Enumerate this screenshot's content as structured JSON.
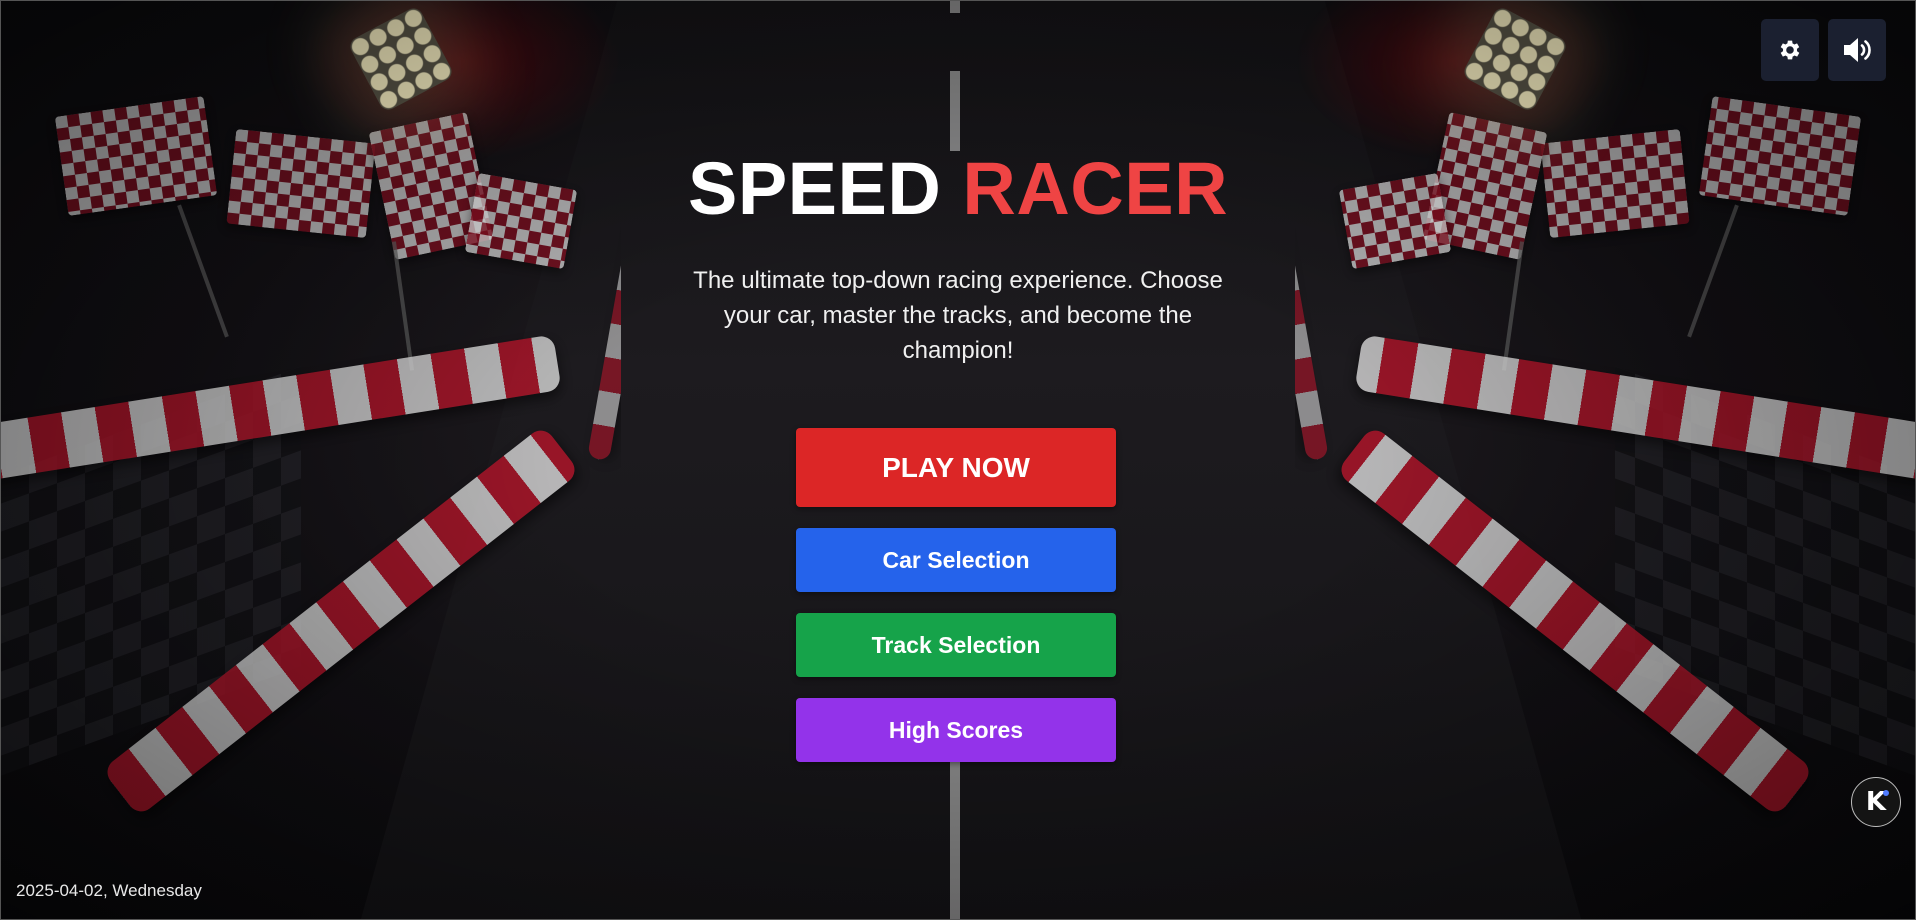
{
  "header": {
    "settings_icon": "gear-icon",
    "sound_icon": "volume-icon"
  },
  "hero": {
    "title_main": "SPEED",
    "title_accent": "RACER",
    "tagline": "The ultimate top-down racing experience. Choose your car, master the tracks, and become the champion!"
  },
  "menu": {
    "play": "PLAY NOW",
    "cars": "Car Selection",
    "tracks": "Track Selection",
    "scores": "High Scores"
  },
  "footer": {
    "date": "2025-04-02, Wednesday",
    "badge": "K"
  },
  "colors": {
    "accent_red": "#ef4444",
    "play": "#dc2626",
    "cars": "#2563eb",
    "tracks": "#16a34a",
    "scores": "#9333ea",
    "icon_button_bg": "#1b2030"
  }
}
